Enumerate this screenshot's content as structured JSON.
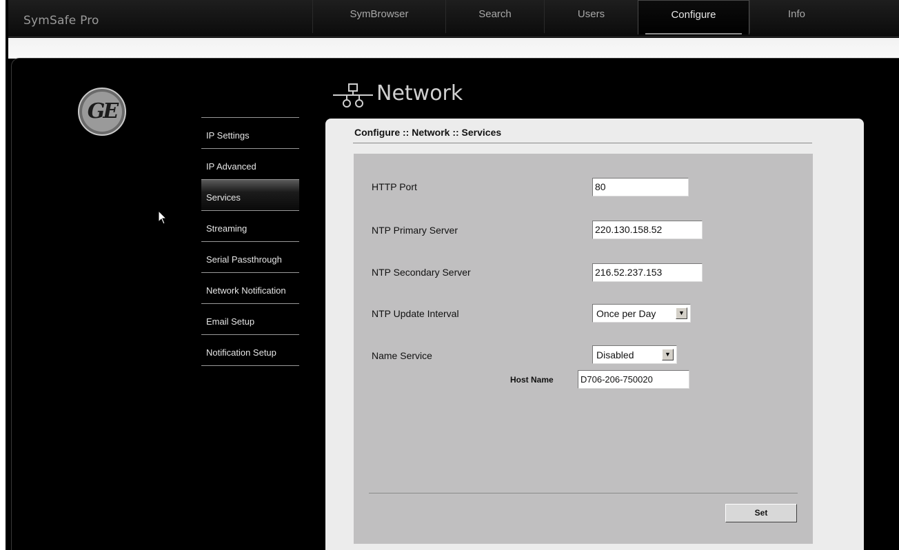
{
  "app": {
    "brand": "SymSafe Pro"
  },
  "tabs": [
    {
      "label": "SymBrowser"
    },
    {
      "label": "Search"
    },
    {
      "label": "Users"
    },
    {
      "label": "Configure",
      "active": true
    },
    {
      "label": "Info"
    }
  ],
  "logo": {
    "text": "GE"
  },
  "page": {
    "title": "Network",
    "icon": "network-icon",
    "breadcrumb": "Configure :: Network :: Services"
  },
  "sidenav": {
    "items": [
      {
        "label": "IP Settings"
      },
      {
        "label": "IP Advanced"
      },
      {
        "label": "Services",
        "active": true
      },
      {
        "label": "Streaming"
      },
      {
        "label": "Serial Passthrough"
      },
      {
        "label": "Network Notification"
      },
      {
        "label": "Email Setup"
      },
      {
        "label": "Notification Setup"
      }
    ]
  },
  "form": {
    "http_port": {
      "label": "HTTP Port",
      "value": "80"
    },
    "ntp_primary": {
      "label": "NTP Primary Server",
      "value": "220.130.158.52"
    },
    "ntp_secondary": {
      "label": "NTP Secondary Server",
      "value": "216.52.237.153"
    },
    "ntp_interval": {
      "label": "NTP Update Interval",
      "value": "Once per Day"
    },
    "name_service": {
      "label": "Name Service",
      "value": "Disabled"
    },
    "host_name": {
      "label": "Host Name",
      "value": "D706-206-750020"
    },
    "set_label": "Set"
  },
  "colors": {
    "background": "#000000",
    "panel": "#ececec",
    "form_bg": "#c0bfc0",
    "nav_text": "#e6e6e6"
  }
}
